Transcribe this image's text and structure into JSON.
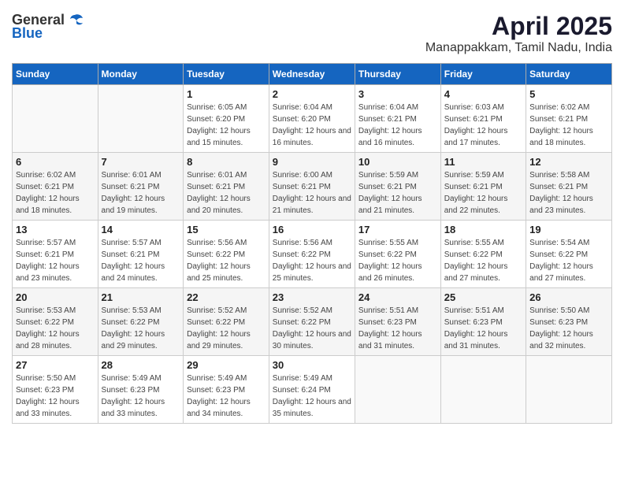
{
  "logo": {
    "general": "General",
    "blue": "Blue"
  },
  "title": "April 2025",
  "location": "Manappakkam, Tamil Nadu, India",
  "weekdays": [
    "Sunday",
    "Monday",
    "Tuesday",
    "Wednesday",
    "Thursday",
    "Friday",
    "Saturday"
  ],
  "weeks": [
    [
      {
        "day": "",
        "sunrise": "",
        "sunset": "",
        "daylight": ""
      },
      {
        "day": "",
        "sunrise": "",
        "sunset": "",
        "daylight": ""
      },
      {
        "day": "1",
        "sunrise": "Sunrise: 6:05 AM",
        "sunset": "Sunset: 6:20 PM",
        "daylight": "Daylight: 12 hours and 15 minutes."
      },
      {
        "day": "2",
        "sunrise": "Sunrise: 6:04 AM",
        "sunset": "Sunset: 6:20 PM",
        "daylight": "Daylight: 12 hours and 16 minutes."
      },
      {
        "day": "3",
        "sunrise": "Sunrise: 6:04 AM",
        "sunset": "Sunset: 6:21 PM",
        "daylight": "Daylight: 12 hours and 16 minutes."
      },
      {
        "day": "4",
        "sunrise": "Sunrise: 6:03 AM",
        "sunset": "Sunset: 6:21 PM",
        "daylight": "Daylight: 12 hours and 17 minutes."
      },
      {
        "day": "5",
        "sunrise": "Sunrise: 6:02 AM",
        "sunset": "Sunset: 6:21 PM",
        "daylight": "Daylight: 12 hours and 18 minutes."
      }
    ],
    [
      {
        "day": "6",
        "sunrise": "Sunrise: 6:02 AM",
        "sunset": "Sunset: 6:21 PM",
        "daylight": "Daylight: 12 hours and 18 minutes."
      },
      {
        "day": "7",
        "sunrise": "Sunrise: 6:01 AM",
        "sunset": "Sunset: 6:21 PM",
        "daylight": "Daylight: 12 hours and 19 minutes."
      },
      {
        "day": "8",
        "sunrise": "Sunrise: 6:01 AM",
        "sunset": "Sunset: 6:21 PM",
        "daylight": "Daylight: 12 hours and 20 minutes."
      },
      {
        "day": "9",
        "sunrise": "Sunrise: 6:00 AM",
        "sunset": "Sunset: 6:21 PM",
        "daylight": "Daylight: 12 hours and 21 minutes."
      },
      {
        "day": "10",
        "sunrise": "Sunrise: 5:59 AM",
        "sunset": "Sunset: 6:21 PM",
        "daylight": "Daylight: 12 hours and 21 minutes."
      },
      {
        "day": "11",
        "sunrise": "Sunrise: 5:59 AM",
        "sunset": "Sunset: 6:21 PM",
        "daylight": "Daylight: 12 hours and 22 minutes."
      },
      {
        "day": "12",
        "sunrise": "Sunrise: 5:58 AM",
        "sunset": "Sunset: 6:21 PM",
        "daylight": "Daylight: 12 hours and 23 minutes."
      }
    ],
    [
      {
        "day": "13",
        "sunrise": "Sunrise: 5:57 AM",
        "sunset": "Sunset: 6:21 PM",
        "daylight": "Daylight: 12 hours and 23 minutes."
      },
      {
        "day": "14",
        "sunrise": "Sunrise: 5:57 AM",
        "sunset": "Sunset: 6:21 PM",
        "daylight": "Daylight: 12 hours and 24 minutes."
      },
      {
        "day": "15",
        "sunrise": "Sunrise: 5:56 AM",
        "sunset": "Sunset: 6:22 PM",
        "daylight": "Daylight: 12 hours and 25 minutes."
      },
      {
        "day": "16",
        "sunrise": "Sunrise: 5:56 AM",
        "sunset": "Sunset: 6:22 PM",
        "daylight": "Daylight: 12 hours and 25 minutes."
      },
      {
        "day": "17",
        "sunrise": "Sunrise: 5:55 AM",
        "sunset": "Sunset: 6:22 PM",
        "daylight": "Daylight: 12 hours and 26 minutes."
      },
      {
        "day": "18",
        "sunrise": "Sunrise: 5:55 AM",
        "sunset": "Sunset: 6:22 PM",
        "daylight": "Daylight: 12 hours and 27 minutes."
      },
      {
        "day": "19",
        "sunrise": "Sunrise: 5:54 AM",
        "sunset": "Sunset: 6:22 PM",
        "daylight": "Daylight: 12 hours and 27 minutes."
      }
    ],
    [
      {
        "day": "20",
        "sunrise": "Sunrise: 5:53 AM",
        "sunset": "Sunset: 6:22 PM",
        "daylight": "Daylight: 12 hours and 28 minutes."
      },
      {
        "day": "21",
        "sunrise": "Sunrise: 5:53 AM",
        "sunset": "Sunset: 6:22 PM",
        "daylight": "Daylight: 12 hours and 29 minutes."
      },
      {
        "day": "22",
        "sunrise": "Sunrise: 5:52 AM",
        "sunset": "Sunset: 6:22 PM",
        "daylight": "Daylight: 12 hours and 29 minutes."
      },
      {
        "day": "23",
        "sunrise": "Sunrise: 5:52 AM",
        "sunset": "Sunset: 6:22 PM",
        "daylight": "Daylight: 12 hours and 30 minutes."
      },
      {
        "day": "24",
        "sunrise": "Sunrise: 5:51 AM",
        "sunset": "Sunset: 6:23 PM",
        "daylight": "Daylight: 12 hours and 31 minutes."
      },
      {
        "day": "25",
        "sunrise": "Sunrise: 5:51 AM",
        "sunset": "Sunset: 6:23 PM",
        "daylight": "Daylight: 12 hours and 31 minutes."
      },
      {
        "day": "26",
        "sunrise": "Sunrise: 5:50 AM",
        "sunset": "Sunset: 6:23 PM",
        "daylight": "Daylight: 12 hours and 32 minutes."
      }
    ],
    [
      {
        "day": "27",
        "sunrise": "Sunrise: 5:50 AM",
        "sunset": "Sunset: 6:23 PM",
        "daylight": "Daylight: 12 hours and 33 minutes."
      },
      {
        "day": "28",
        "sunrise": "Sunrise: 5:49 AM",
        "sunset": "Sunset: 6:23 PM",
        "daylight": "Daylight: 12 hours and 33 minutes."
      },
      {
        "day": "29",
        "sunrise": "Sunrise: 5:49 AM",
        "sunset": "Sunset: 6:23 PM",
        "daylight": "Daylight: 12 hours and 34 minutes."
      },
      {
        "day": "30",
        "sunrise": "Sunrise: 5:49 AM",
        "sunset": "Sunset: 6:24 PM",
        "daylight": "Daylight: 12 hours and 35 minutes."
      },
      {
        "day": "",
        "sunrise": "",
        "sunset": "",
        "daylight": ""
      },
      {
        "day": "",
        "sunrise": "",
        "sunset": "",
        "daylight": ""
      },
      {
        "day": "",
        "sunrise": "",
        "sunset": "",
        "daylight": ""
      }
    ]
  ]
}
